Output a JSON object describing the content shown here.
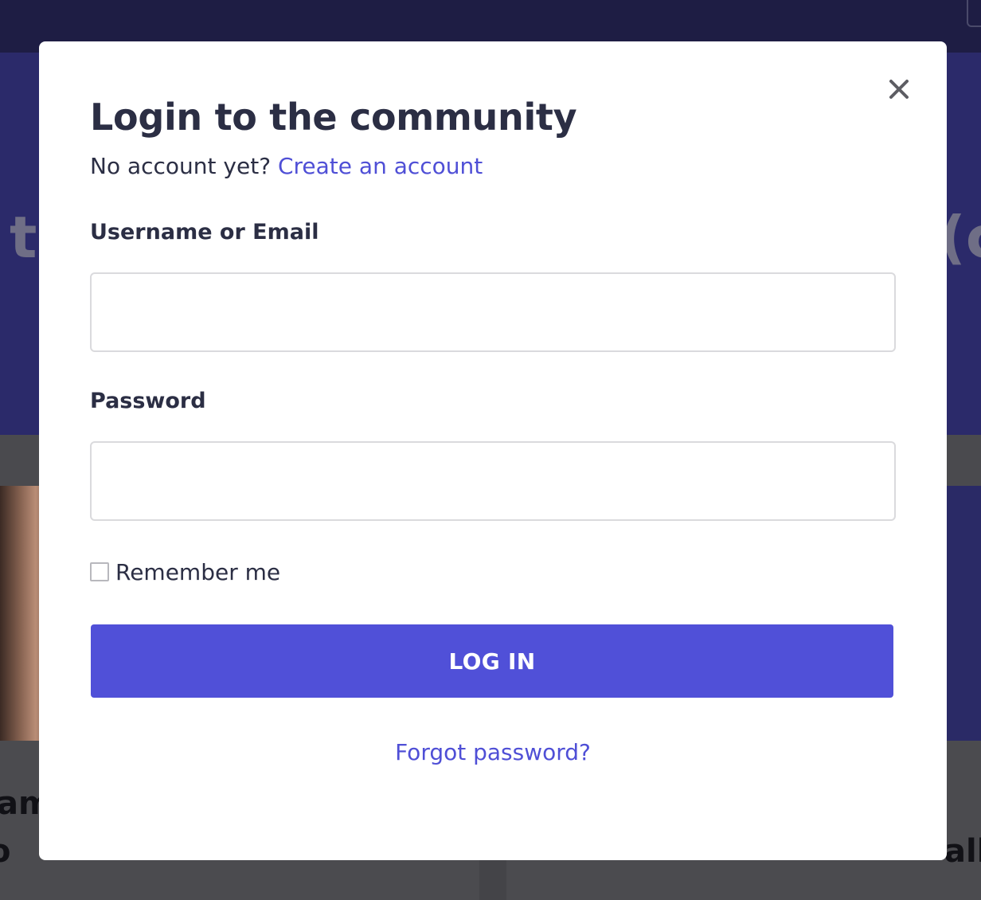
{
  "background": {
    "hero_left_fragment": "th",
    "hero_right_fragment": "(c",
    "lower_left_fragment_1": "am",
    "lower_left_fragment_2": "o",
    "lower_right_fragment": "all"
  },
  "modal": {
    "close_icon": "close-icon",
    "title": "Login to the community",
    "subtitle_prefix": "No account yet?",
    "create_account_link": "Create an account",
    "username_label": "Username or Email",
    "username_value": "",
    "password_label": "Password",
    "password_value": "",
    "remember_label": "Remember me",
    "remember_checked": false,
    "login_button": "LOG IN",
    "forgot_link": "Forgot password?"
  },
  "colors": {
    "accent": "#5050d8",
    "link": "#4f4fd6",
    "text": "#2b2e44",
    "overlay_top": "#1e1d44",
    "overlay_hero": "#2b2a6a"
  }
}
